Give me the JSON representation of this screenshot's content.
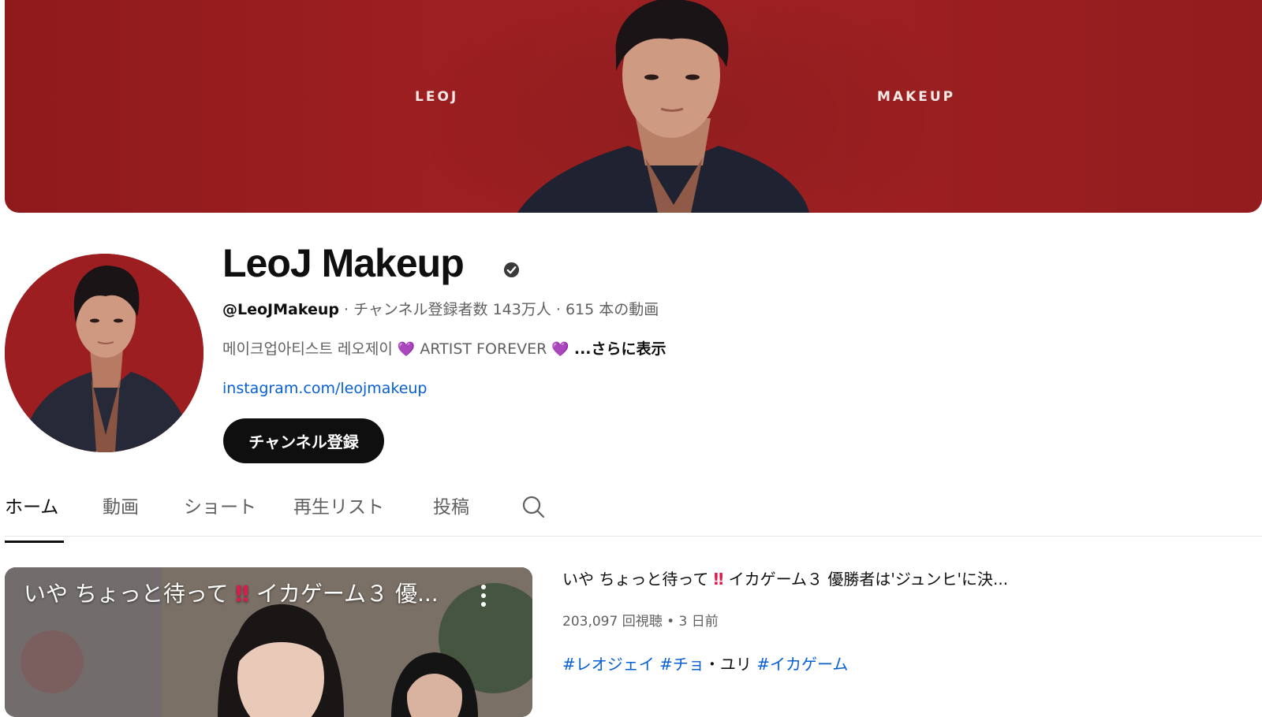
{
  "banner": {
    "left_text": "LEOJ",
    "right_text": "MAKEUP",
    "background_color": "#9d1f21"
  },
  "channel": {
    "name": "LeoJ Makeup",
    "verified_icon": "verified-check-icon",
    "handle": "@LeoJMakeup",
    "stats": "· チャンネル登録者数 143万人 · 615 本の動画",
    "description_korean": "메이크업아티스트 레오제이",
    "heart": "💜",
    "description_english": "ARTIST FOREVER",
    "more_label": "...さらに表示",
    "link": "instagram.com/leojmakeup",
    "subscribe_label": "チャンネル登録"
  },
  "tabs": [
    {
      "label": "ホーム",
      "active": true
    },
    {
      "label": "動画",
      "active": false
    },
    {
      "label": "ショート",
      "active": false
    },
    {
      "label": "再生リスト",
      "active": false
    },
    {
      "label": "投稿",
      "active": false
    }
  ],
  "search_icon": "search-icon",
  "featured_video": {
    "thumb_title_part1": "いや ちょっと待って",
    "thumb_title_excl": "‼",
    "thumb_title_part2": "イカゲーム３ 優...",
    "title_part1": "いや ちょっと待って",
    "title_excl": "‼",
    "title_part2": "イカゲーム３ 優勝者は'ジュンヒ'に決...",
    "stats": "203,097 回視聴 • 3 日前",
    "hashtag1": "#レオジェイ",
    "hashtag2": "#チョ",
    "hashtag_sep": "・ユリ",
    "hashtag3": "#イカゲーム"
  },
  "colors": {
    "link": "#065fd4",
    "subscribe_bg": "#0f0f0f",
    "banner_red": "#9d1f21"
  }
}
